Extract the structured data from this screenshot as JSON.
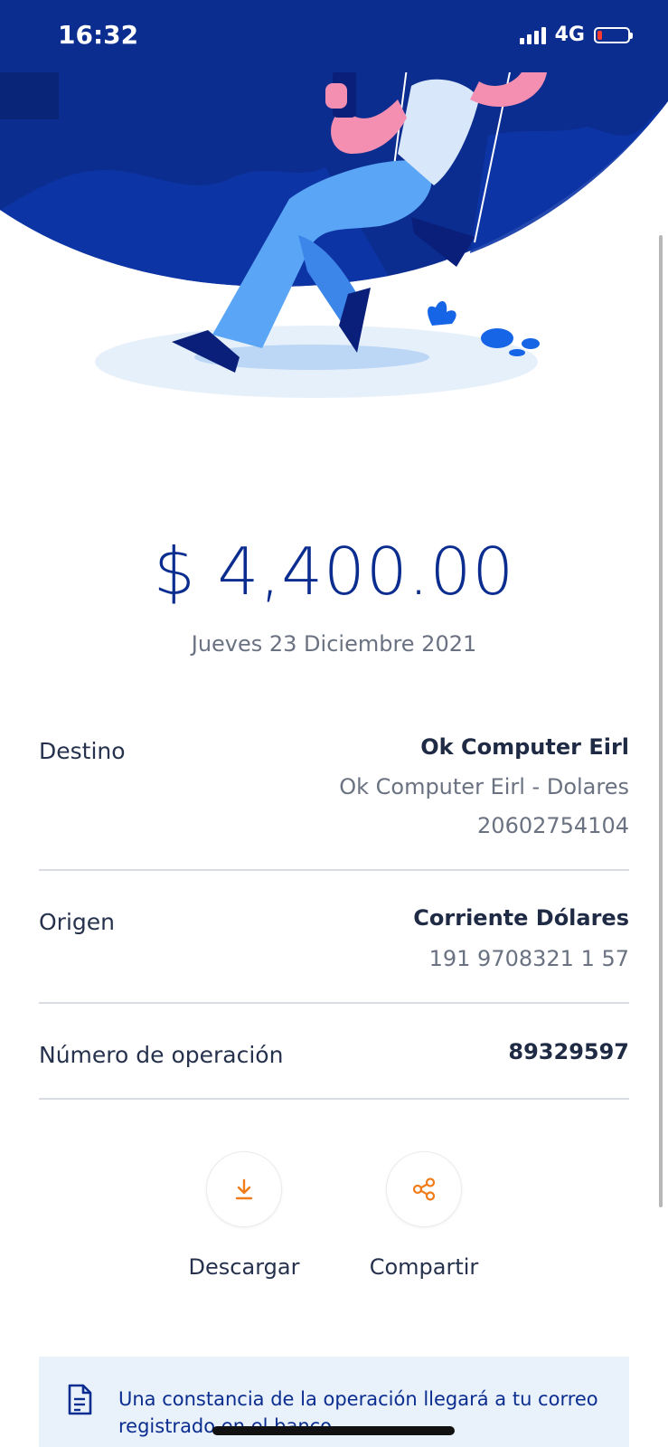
{
  "status": {
    "time": "16:32",
    "network": "4G"
  },
  "transfer": {
    "amount": "$ 4,400.00",
    "date": "Jueves 23 Diciembre 2021"
  },
  "details": {
    "destino": {
      "label": "Destino",
      "name": "Ok Computer Eirl",
      "account": "Ok Computer Eirl - Dolares",
      "number": "20602754104"
    },
    "origen": {
      "label": "Origen",
      "name": "Corriente Dólares",
      "number": "191 9708321 1 57"
    },
    "operacion": {
      "label": "Número de operación",
      "value": "89329597"
    }
  },
  "actions": {
    "download_label": "Descargar",
    "share_label": "Compartir"
  },
  "notice": {
    "text": "Una constancia de la operación llegará a tu correo registrado en el banco"
  },
  "icons": {
    "download": "download-icon",
    "share": "share-icon",
    "document": "document-icon"
  },
  "colors": {
    "brand": "#0b2d8f",
    "accent": "#f07c1a",
    "notice_bg": "#e9f1fb"
  }
}
